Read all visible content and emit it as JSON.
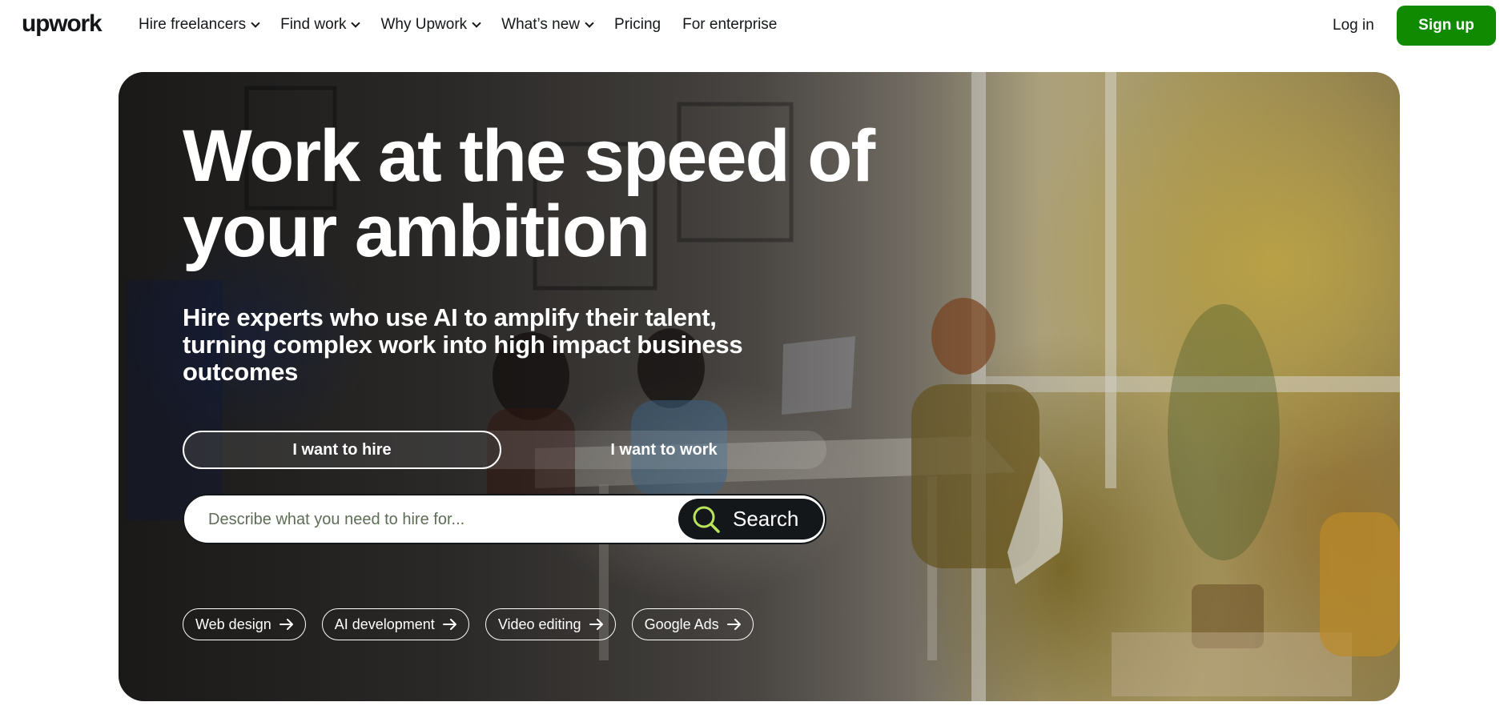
{
  "header": {
    "logo": "upwork",
    "nav": [
      {
        "label": "Hire freelancers",
        "dropdown": true
      },
      {
        "label": "Find work",
        "dropdown": true
      },
      {
        "label": "Why Upwork",
        "dropdown": true
      },
      {
        "label": "What’s new",
        "dropdown": true
      },
      {
        "label": "Pricing",
        "dropdown": false
      },
      {
        "label": "For enterprise",
        "dropdown": false
      }
    ],
    "login": "Log in",
    "signup": "Sign up"
  },
  "hero": {
    "title": "Work at the speed of your ambition",
    "subtitle": "Hire experts who use AI to amplify their talent, turning complex work into high impact business outcomes",
    "toggle": {
      "hire": "I want to hire",
      "work": "I want to work",
      "selected": "hire"
    },
    "search": {
      "placeholder": "Describe what you need to hire for...",
      "value": "",
      "button": "Search"
    },
    "chips": [
      "Web design",
      "AI development",
      "Video editing",
      "Google Ads"
    ]
  },
  "colors": {
    "brand": "#108a00",
    "text": "#14171a",
    "search_icon": "#b9e35b"
  },
  "icons": {
    "search": "search-icon",
    "chip_arrow": "arrow-right-icon",
    "nav_dropdown": "chevron-down-icon"
  }
}
